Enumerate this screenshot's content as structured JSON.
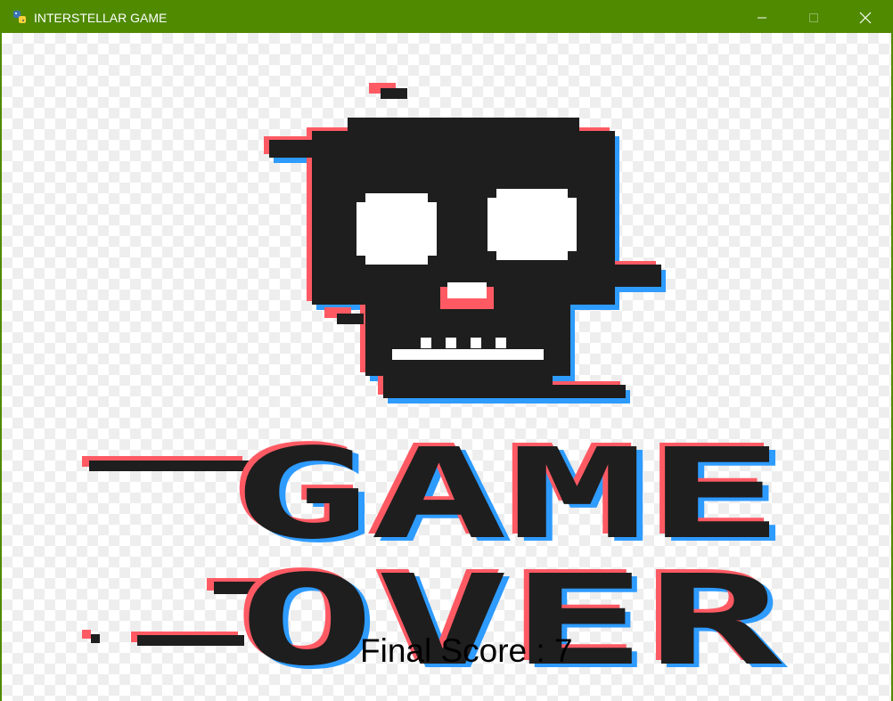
{
  "window": {
    "title": "INTERSTELLAR GAME",
    "titlebar_color": "#4f8a00",
    "controls": {
      "minimize_icon": "minimize-icon",
      "maximize_icon": "maximize-icon",
      "close_icon": "close-icon"
    },
    "app_icon": "python-icon"
  },
  "game": {
    "screen": "game-over",
    "art": {
      "line1": "GAME",
      "line2": "OVER",
      "ink_color": "#1e1e1e",
      "glitch_red": "#ff5a64",
      "glitch_blue": "#2e9bff",
      "background": "checkerboard"
    },
    "score": {
      "label": "Final Score : ",
      "value": "7"
    }
  }
}
